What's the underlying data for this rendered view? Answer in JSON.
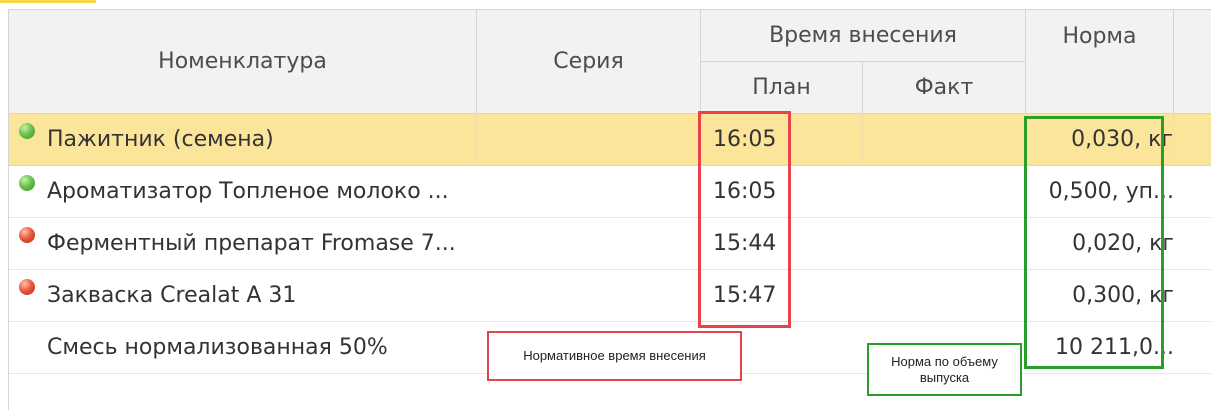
{
  "table": {
    "headers": {
      "nomenclature": "Номенклатура",
      "series": "Серия",
      "time_group": "Время внесения",
      "plan": "План",
      "fact": "Факт",
      "norm": "Норма"
    },
    "rows": [
      {
        "name": "Пажитник (семена)",
        "status": "green",
        "series": "",
        "plan": "16:05",
        "fact": "",
        "norm": "0,030, кг"
      },
      {
        "name": "Ароматизатор Топленое молоко ...",
        "status": "green",
        "series": "",
        "plan": "16:05",
        "fact": "",
        "norm": "0,500, уп..."
      },
      {
        "name": "Ферментный препарат Fromase 7...",
        "status": "red",
        "series": "",
        "plan": "15:44",
        "fact": "",
        "norm": "0,020, кг"
      },
      {
        "name": "Закваска Crealat A 31",
        "status": "red",
        "series": "",
        "plan": "15:47",
        "fact": "",
        "norm": "0,300, кг"
      },
      {
        "name": "Смесь нормализованная 50%",
        "status": "",
        "series": "",
        "plan": "",
        "fact": "",
        "norm": "10 211,0..."
      }
    ]
  },
  "annotations": {
    "time_callout": "Нормативное время внесения",
    "norm_callout": "Норма по объему выпуска",
    "time_color": "#e8434a",
    "norm_color": "#2a9d2a"
  },
  "colors": {
    "selected_row": "#fbe59a",
    "header_bg": "#f2f2f2"
  }
}
